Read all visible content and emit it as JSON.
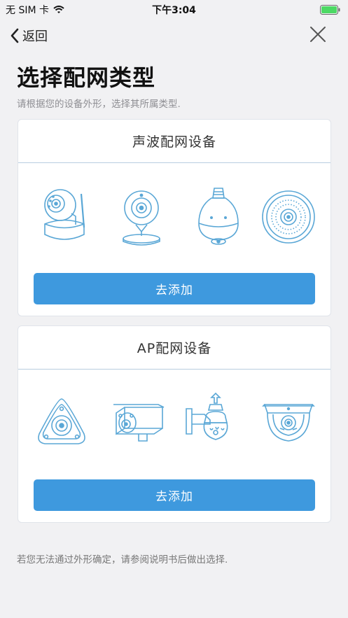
{
  "status": {
    "carrier": "无 SIM 卡",
    "time": "下午3:04"
  },
  "nav": {
    "back_label": "返回"
  },
  "page": {
    "title": "选择配网类型",
    "subtitle": "请根据您的设备外形，选择其所属类型."
  },
  "cards": [
    {
      "title": "声波配网设备",
      "button": "去添加",
      "devices": [
        "pan-tilt-camera-icon",
        "cube-camera-icon",
        "bulb-camera-icon",
        "round-panel-camera-icon"
      ]
    },
    {
      "title": "AP配网设备",
      "button": "去添加",
      "devices": [
        "fisheye-camera-icon",
        "bullet-camera-icon",
        "wall-ptz-camera-icon",
        "dome-camera-icon"
      ]
    }
  ],
  "footer": {
    "note": "若您无法通过外形确定，请参阅说明书后做出选择."
  },
  "colors": {
    "accent": "#3e99de",
    "icon_stroke": "#5aa7d6",
    "background": "#f1f1f3"
  }
}
